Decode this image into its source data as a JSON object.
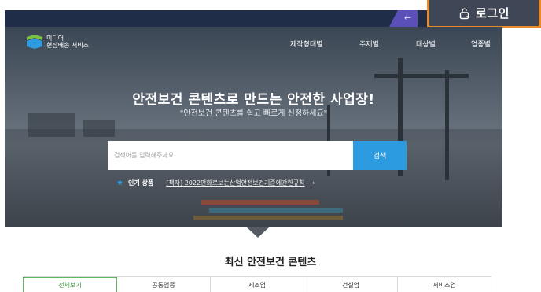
{
  "topbar": {
    "arrow": "←"
  },
  "login": {
    "label": "로그인",
    "icon": "login-lock-icon"
  },
  "brand": {
    "line1": "미디어",
    "line2": "현장배송 서비스"
  },
  "nav": {
    "items": [
      "제작형태별",
      "주제별",
      "대상별",
      "업종별"
    ]
  },
  "hero": {
    "title": "안전보건 콘텐츠로 만드는 안전한 사업장!",
    "subtitle": "\"안전보건 콘텐츠를 쉽고 빠르게 신청하세요\""
  },
  "search": {
    "placeholder": "검색어를 입력해주세요.",
    "button": "검색"
  },
  "popular": {
    "label": "인기 상품",
    "link": "[책자] 2022만화로보는산업안전보건기준에관한규칙",
    "more": "→"
  },
  "section": {
    "title": "최신 안전보건 콘텐츠"
  },
  "tabs": [
    "전체보기",
    "공통업종",
    "제조업",
    "건설업",
    "서비스업"
  ],
  "colors": {
    "accent_blue": "#2c9bdf",
    "login_frame": "#e98a2a",
    "active_tab": "#5cb85c",
    "topbar": "#1f2d48"
  }
}
